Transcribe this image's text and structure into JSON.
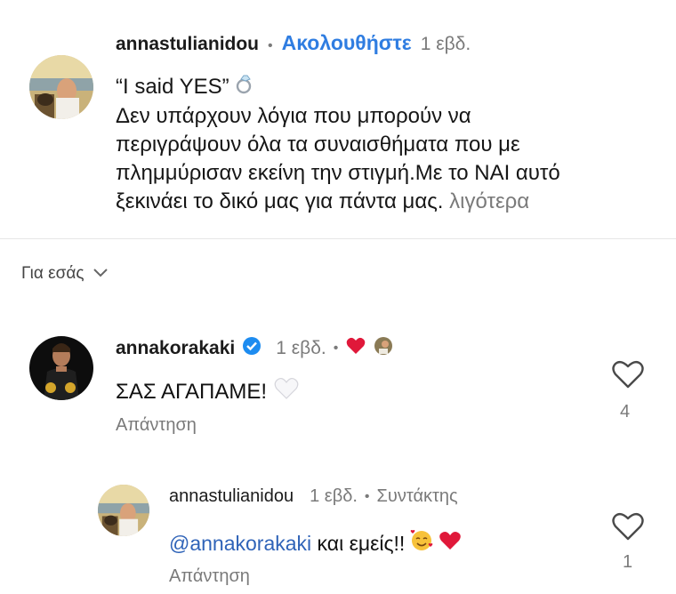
{
  "caption": {
    "username": "annastulianidou",
    "separator": "•",
    "follow_label": "Ακολουθήστε",
    "time": "1 εβδ.",
    "lines": [
      "“I said YES”",
      "Δεν υπάρχουν λόγια που μπορούν να",
      "περιγράψουν όλα τα συναισθήματα που με",
      "πλημμύρισαν εκείνη την στιγμή.Με το ΝΑΙ αυτό",
      "ξεκινάει το δικό μας για πάντα μας."
    ],
    "more_label": "λιγότερα",
    "emoji": "ring-icon"
  },
  "section": {
    "label": "Για εσάς"
  },
  "comments": [
    {
      "username": "annakorakaki",
      "verified": true,
      "time": "1 εβδ.",
      "separator": "•",
      "text": "ΣΑΣ ΑΓΑΠΑΜΕ!",
      "reply_label": "Απάντηση",
      "like_count": "4"
    },
    {
      "username": "annastulianidou",
      "time": "1 εβδ.",
      "separator": "•",
      "author_label": "Συντάκτης",
      "mention": "@annakorakaki",
      "text": " και εμείς!!",
      "reply_label": "Απάντηση",
      "like_count": "1"
    }
  ],
  "colors": {
    "follow": "#2f7de1",
    "mention": "#2f63b8",
    "muted": "#7a7a7a",
    "heart_red": "#e0183a",
    "verified": "#1d8cf0"
  }
}
